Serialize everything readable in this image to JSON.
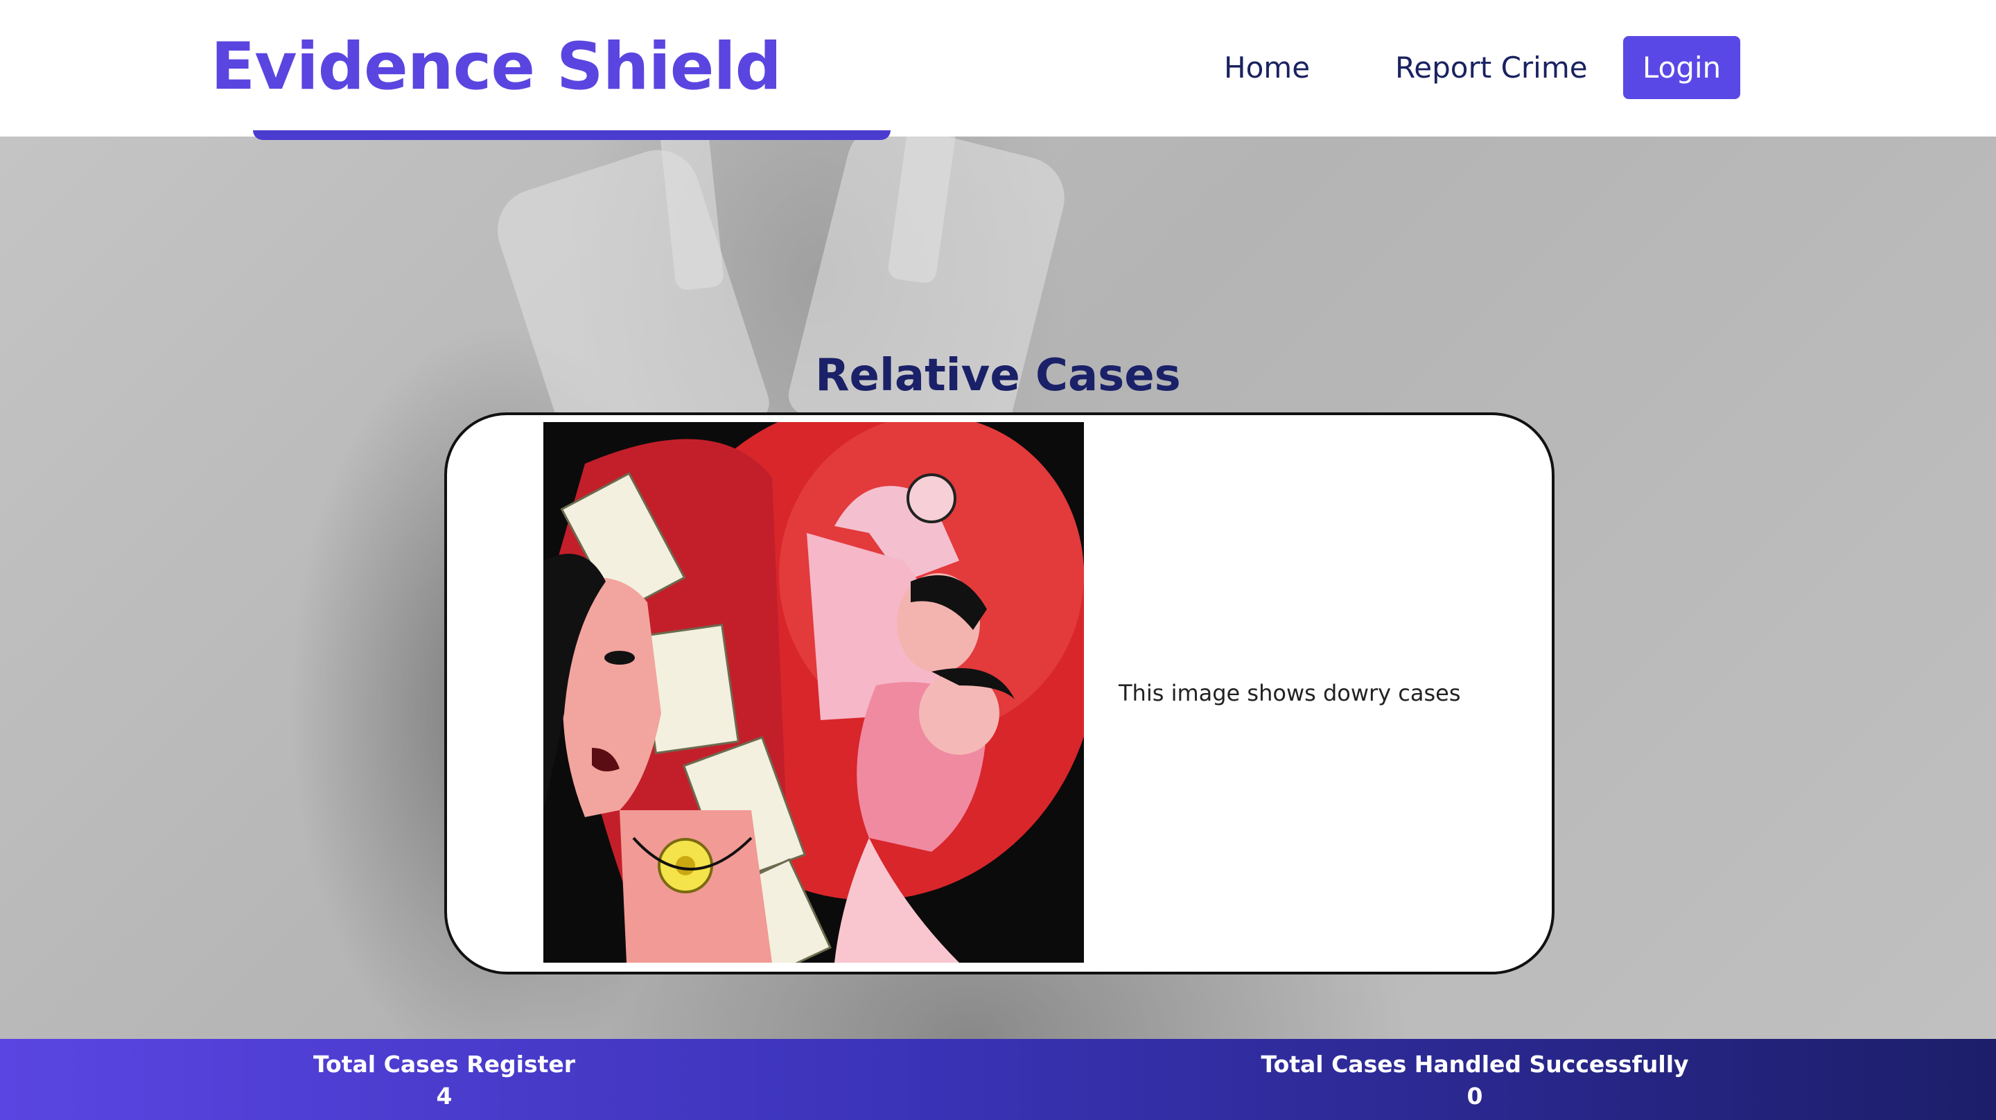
{
  "header": {
    "brand": "Evidence Shield",
    "nav": {
      "home": "Home",
      "report_crime": "Report Crime",
      "login": "Login"
    }
  },
  "main": {
    "section_title": "Relative Cases",
    "case": {
      "image_icon": "dowry-illustration-icon",
      "description": "This image shows dowry cases"
    }
  },
  "stats": {
    "registered_label": "Total Cases Register",
    "registered_value": "4",
    "handled_label": "Total Cases Handled Successfully",
    "handled_value": "0"
  },
  "colors": {
    "brand": "#5b45e0",
    "login_button": "#5a48e6",
    "heading": "#1a2168",
    "nav_text": "#1a2260",
    "stats_gradient_start": "#5a45e2",
    "stats_gradient_end": "#1c1e6a"
  }
}
